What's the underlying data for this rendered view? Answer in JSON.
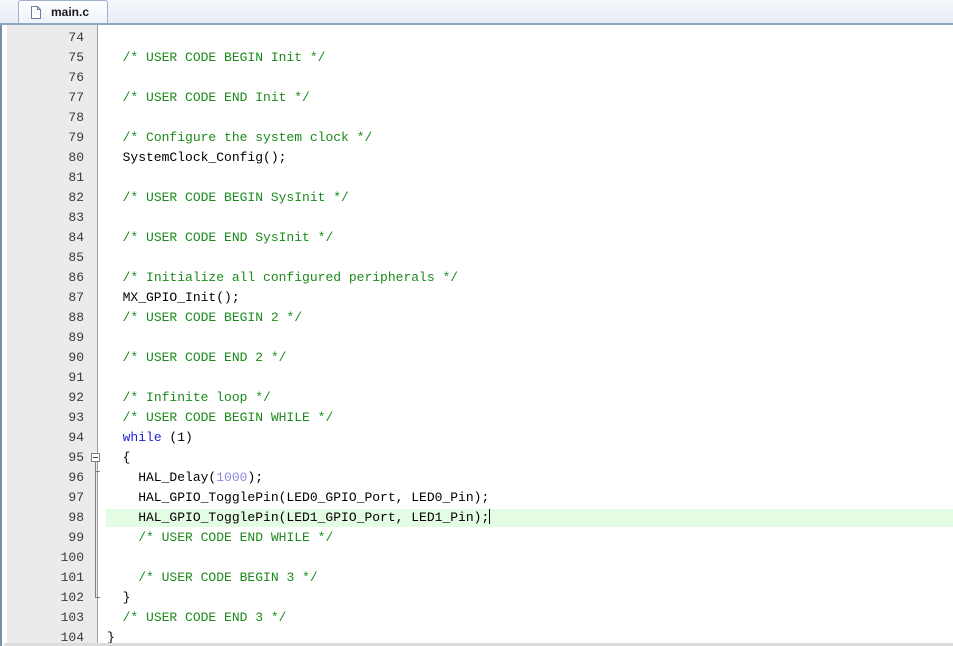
{
  "tab": {
    "label": "main.c",
    "icon": "file-icon"
  },
  "lines": [
    {
      "n": "74",
      "segments": []
    },
    {
      "n": "75",
      "segments": [
        {
          "t": "  ",
          "k": "text"
        },
        {
          "t": "/* USER CODE BEGIN Init */",
          "k": "comment"
        }
      ]
    },
    {
      "n": "76",
      "segments": []
    },
    {
      "n": "77",
      "segments": [
        {
          "t": "  ",
          "k": "text"
        },
        {
          "t": "/* USER CODE END Init */",
          "k": "comment"
        }
      ]
    },
    {
      "n": "78",
      "segments": []
    },
    {
      "n": "79",
      "segments": [
        {
          "t": "  ",
          "k": "text"
        },
        {
          "t": "/* Configure the system clock */",
          "k": "comment"
        }
      ]
    },
    {
      "n": "80",
      "segments": [
        {
          "t": "  SystemClock_Config();",
          "k": "text"
        }
      ]
    },
    {
      "n": "81",
      "segments": []
    },
    {
      "n": "82",
      "segments": [
        {
          "t": "  ",
          "k": "text"
        },
        {
          "t": "/* USER CODE BEGIN SysInit */",
          "k": "comment"
        }
      ]
    },
    {
      "n": "83",
      "segments": []
    },
    {
      "n": "84",
      "segments": [
        {
          "t": "  ",
          "k": "text"
        },
        {
          "t": "/* USER CODE END SysInit */",
          "k": "comment"
        }
      ]
    },
    {
      "n": "85",
      "segments": []
    },
    {
      "n": "86",
      "segments": [
        {
          "t": "  ",
          "k": "text"
        },
        {
          "t": "/* Initialize all configured peripherals */",
          "k": "comment"
        }
      ]
    },
    {
      "n": "87",
      "segments": [
        {
          "t": "  MX_GPIO_Init();",
          "k": "text"
        }
      ]
    },
    {
      "n": "88",
      "segments": [
        {
          "t": "  ",
          "k": "text"
        },
        {
          "t": "/* USER CODE BEGIN 2 */",
          "k": "comment"
        }
      ]
    },
    {
      "n": "89",
      "segments": []
    },
    {
      "n": "90",
      "segments": [
        {
          "t": "  ",
          "k": "text"
        },
        {
          "t": "/* USER CODE END 2 */",
          "k": "comment"
        }
      ]
    },
    {
      "n": "91",
      "segments": []
    },
    {
      "n": "92",
      "segments": [
        {
          "t": "  ",
          "k": "text"
        },
        {
          "t": "/* Infinite loop */",
          "k": "comment"
        }
      ]
    },
    {
      "n": "93",
      "segments": [
        {
          "t": "  ",
          "k": "text"
        },
        {
          "t": "/* USER CODE BEGIN WHILE */",
          "k": "comment"
        }
      ]
    },
    {
      "n": "94",
      "segments": [
        {
          "t": "  ",
          "k": "text"
        },
        {
          "t": "while",
          "k": "keyword"
        },
        {
          "t": " (1)",
          "k": "text"
        }
      ]
    },
    {
      "n": "95",
      "fold": "open",
      "segments": [
        {
          "t": "  {",
          "k": "text"
        }
      ]
    },
    {
      "n": "96",
      "fold": "line",
      "segments": [
        {
          "t": "    HAL_Delay(",
          "k": "text"
        },
        {
          "t": "1000",
          "k": "number"
        },
        {
          "t": ");",
          "k": "text"
        }
      ]
    },
    {
      "n": "97",
      "fold": "line",
      "segments": [
        {
          "t": "    HAL_GPIO_TogglePin(LED0_GPIO_Port, LED0_Pin);",
          "k": "text"
        }
      ]
    },
    {
      "n": "98",
      "fold": "line",
      "current": true,
      "caret": true,
      "segments": [
        {
          "t": "    HAL_GPIO_TogglePin(LED1_GPIO_Port, LED1_Pin);",
          "k": "text"
        }
      ]
    },
    {
      "n": "99",
      "fold": "line",
      "segments": [
        {
          "t": "    ",
          "k": "text"
        },
        {
          "t": "/* USER CODE END WHILE */",
          "k": "comment"
        }
      ]
    },
    {
      "n": "100",
      "fold": "line",
      "segments": []
    },
    {
      "n": "101",
      "fold": "line",
      "segments": [
        {
          "t": "    ",
          "k": "text"
        },
        {
          "t": "/* USER CODE BEGIN 3 */",
          "k": "comment"
        }
      ]
    },
    {
      "n": "102",
      "fold": "end",
      "segments": [
        {
          "t": "  }",
          "k": "text"
        }
      ]
    },
    {
      "n": "103",
      "segments": [
        {
          "t": "  ",
          "k": "text"
        },
        {
          "t": "/* USER CODE END 3 */",
          "k": "comment"
        }
      ]
    },
    {
      "n": "104",
      "segments": [
        {
          "t": "}",
          "k": "text"
        }
      ]
    }
  ]
}
